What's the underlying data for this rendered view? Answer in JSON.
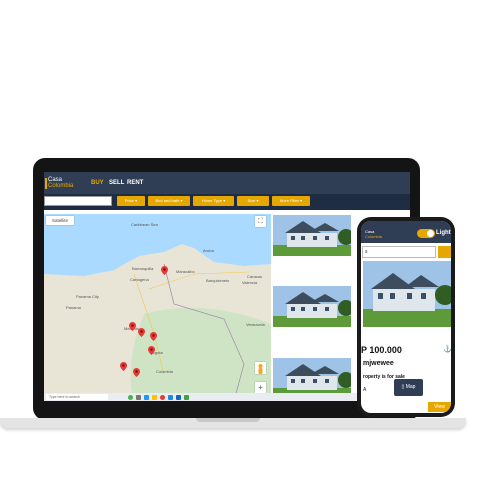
{
  "app": {
    "logo_line1": "Casa",
    "logo_line2": "Colombia",
    "nav": {
      "buy": "BUY",
      "sell": "SELL",
      "rent": "RENT"
    }
  },
  "filters": [
    "Price",
    "Bed and bath",
    "Home Type",
    "Size",
    "More Filter"
  ],
  "map": {
    "satellite_label": "Satellite",
    "labels": [
      "Caribbean Sea",
      "Aruba",
      "Barranquilla",
      "Maracaibo",
      "Cartagena",
      "Barquisimeto",
      "Valencia",
      "Caracas",
      "Panama City",
      "Panama",
      "Medellin",
      "Bogota",
      "Venezuela",
      "Colombia"
    ],
    "marker_count": 7
  },
  "taskbar": {
    "search_placeholder": "Type here to search"
  },
  "listings": {
    "visible_count": 3
  },
  "phone": {
    "logo_line1": "Casa",
    "logo_line2": "Colombia",
    "theme_label": "Light",
    "search_value": "s",
    "price": "P 100.000",
    "title": "mjwewee",
    "status": "roperty is for sale",
    "shortcode": "A",
    "map_button": "Map",
    "view_button": "View"
  },
  "colors": {
    "navy": "#2f3e55",
    "gold": "#e6a800",
    "map_water": "#aadaff",
    "map_land": "#e8e5d7",
    "marker": "#e53935"
  }
}
